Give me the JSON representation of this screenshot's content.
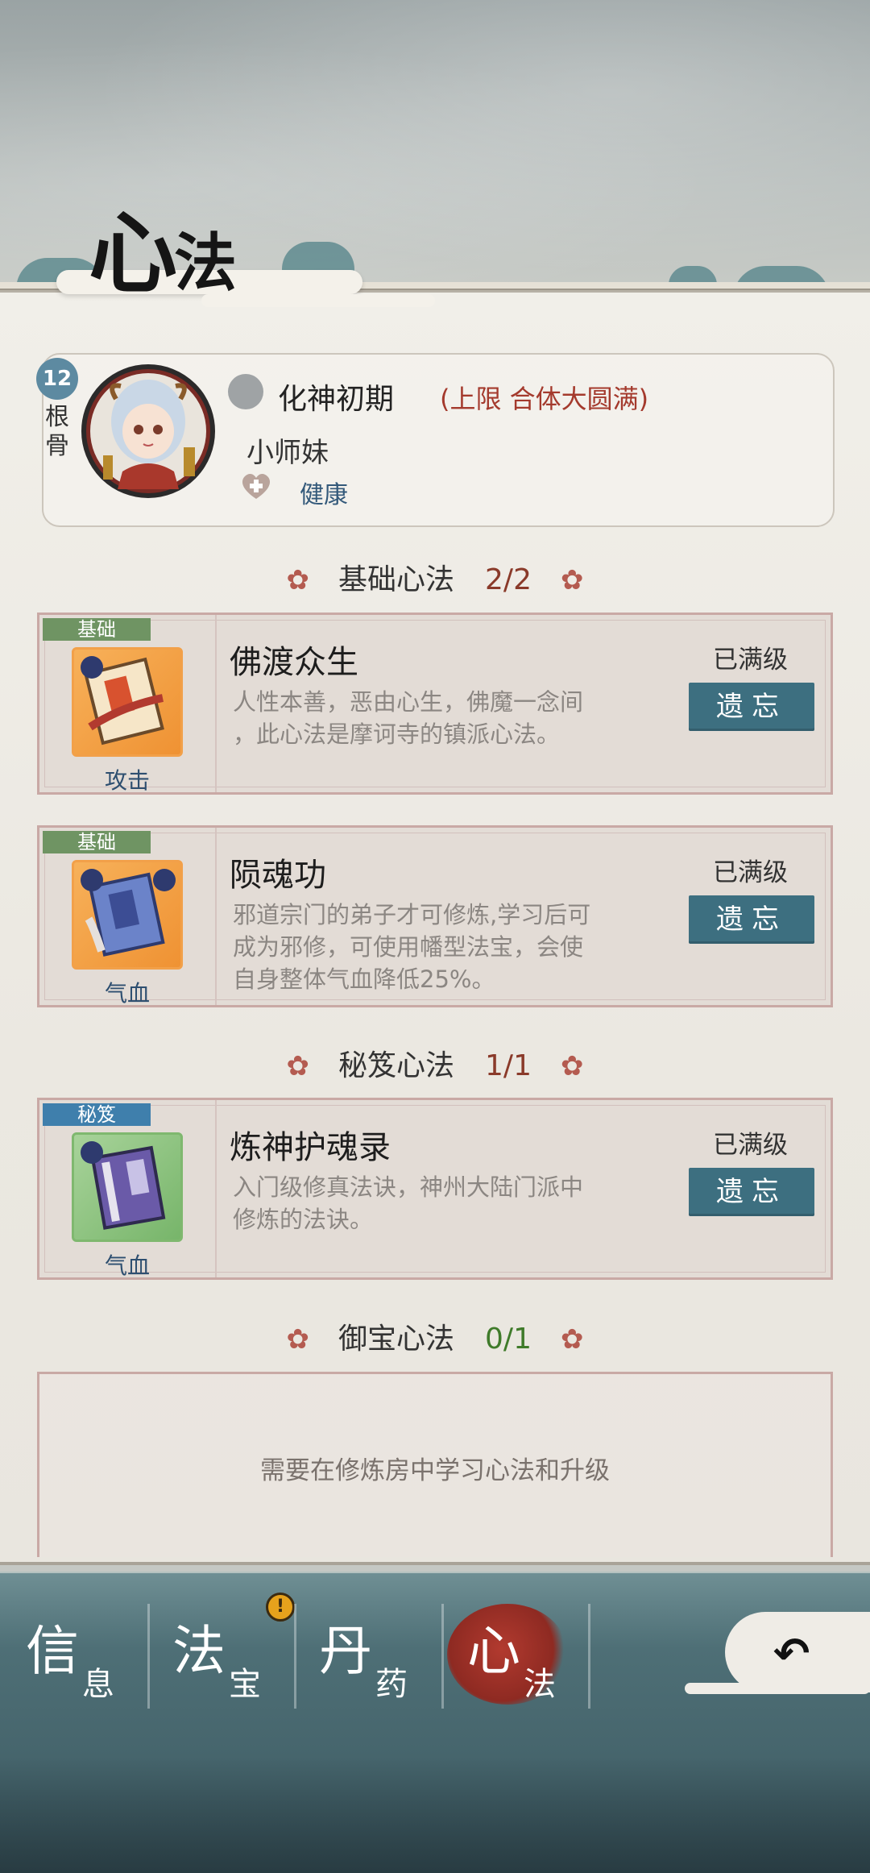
{
  "header": {
    "title_big": "心",
    "title_small": "法"
  },
  "profile": {
    "level": "12",
    "level_label": "根骨",
    "realm": "化神初期",
    "realm_limit": "(上限 合体大圆满)",
    "name": "小师妹",
    "status": "健康"
  },
  "sections": {
    "basic": {
      "title": "基础心法",
      "count": "2/2"
    },
    "secret": {
      "title": "秘笈心法",
      "count": "1/1"
    },
    "treasure": {
      "title": "御宝心法",
      "count": "0/1"
    }
  },
  "skills": [
    {
      "tag": "基础",
      "name": "佛渡众生",
      "type": "攻击",
      "status": "已满级",
      "button": "遗忘",
      "desc_line1": "人性本善，恶由心生，佛魔一念间",
      "desc_line2": "，此心法是摩诃寺的镇派心法。",
      "desc_line3": ""
    },
    {
      "tag": "基础",
      "name": "陨魂功",
      "type": "气血",
      "status": "已满级",
      "button": "遗忘",
      "desc_line1": "邪道宗门的弟子才可修炼,学习后可",
      "desc_line2": "成为邪修，可使用幡型法宝，会使",
      "desc_line3": "自身整体气血降低25%。"
    },
    {
      "tag": "秘笈",
      "name": "炼神护魂录",
      "type": "气血",
      "status": "已满级",
      "button": "遗忘",
      "desc_line1": "入门级修真法诀，神州大陆门派中",
      "desc_line2": "修炼的法诀。",
      "desc_line3": ""
    }
  ],
  "treasure_empty": "需要在修炼房中学习心法和升级",
  "nav": [
    {
      "big": "信",
      "small": "息"
    },
    {
      "big": "法",
      "small": "宝"
    },
    {
      "big": "丹",
      "small": "药"
    },
    {
      "big": "心",
      "small": "法"
    }
  ],
  "nav_alert": "!",
  "back_glyph": "↶",
  "colors": {
    "accent_button": "#3d6f80",
    "active_nav": "#b23a2f",
    "limit_text": "#a43a2d"
  }
}
